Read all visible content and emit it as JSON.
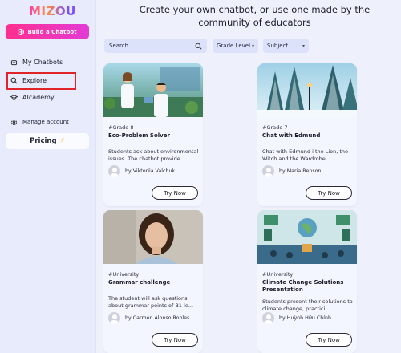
{
  "app": {
    "logo": "MIZOU"
  },
  "sidebar": {
    "build_label": "Build a Chatbot",
    "items": [
      {
        "label": "My Chatbots",
        "icon": "robot-icon"
      },
      {
        "label": "Explore",
        "icon": "search-icon"
      },
      {
        "label": "AIcademy",
        "icon": "graduation-cap-icon"
      },
      {
        "label": "Manage account",
        "icon": "gear-icon"
      }
    ],
    "pricing_label": "Pricing"
  },
  "header": {
    "link_text": "Create your own chatbot",
    "rest_text": ", or use one made by the community of educators"
  },
  "filters": {
    "search_placeholder": "Search",
    "grade_label": "Grade Level",
    "subject_label": "Subject"
  },
  "cards": [
    {
      "grade": "#Grade 8",
      "title": "Eco-Problem Solver",
      "description": "Students ask about environmental issues. The chatbot provide...",
      "author": "by Viktoriia Valchuk",
      "button": "Try Now"
    },
    {
      "grade": "#Grade 7",
      "title": "Chat with Edmund",
      "description": "Chat with Edmund i the Lion, the Witch and the Wardrobe.",
      "author": "by Maria Benson",
      "button": "Try Now"
    },
    {
      "grade": "#University",
      "title": "Grammar challenge",
      "description": "The student will ask questions about grammar points of B1 le...",
      "author": "by Carmen Alonso Robles",
      "button": "Try Now"
    },
    {
      "grade": "#University",
      "title": "Climate Change Solutions Presentation",
      "description": "Students present their solutions to climate change, practici...",
      "author": "by Huỳnh Hữu Chính",
      "button": "Try Now"
    }
  ],
  "colors": {
    "accent_pink": "#ff2f8d",
    "highlight_red": "#e0242a",
    "background": "#eef0fb"
  }
}
